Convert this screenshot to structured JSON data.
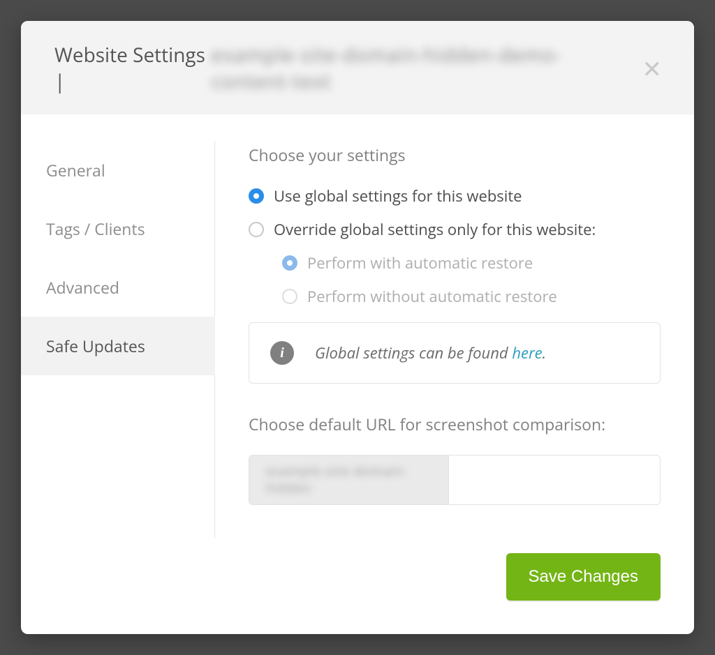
{
  "header": {
    "title_prefix": "Website Settings |",
    "site_label": "example-site-domain-hidden-demo-content-text"
  },
  "sidebar": {
    "items": [
      {
        "label": "General",
        "active": false
      },
      {
        "label": "Tags / Clients",
        "active": false
      },
      {
        "label": "Advanced",
        "active": false
      },
      {
        "label": "Safe Updates",
        "active": true
      }
    ]
  },
  "content": {
    "section1_heading": "Choose your settings",
    "option_global": "Use global settings for this website",
    "option_override": "Override global settings only for this website:",
    "sub_with_restore": "Perform with automatic restore",
    "sub_without_restore": "Perform without automatic restore",
    "info_text": "Global settings can be found ",
    "info_link": "here",
    "info_period": ".",
    "section2_heading": "Choose default URL for screenshot comparison:",
    "url_prefix": "example-site-domain-hidden",
    "url_value": ""
  },
  "footer": {
    "save_label": "Save Changes"
  },
  "state": {
    "selected_mode": "global",
    "selected_sub": "with_restore"
  }
}
